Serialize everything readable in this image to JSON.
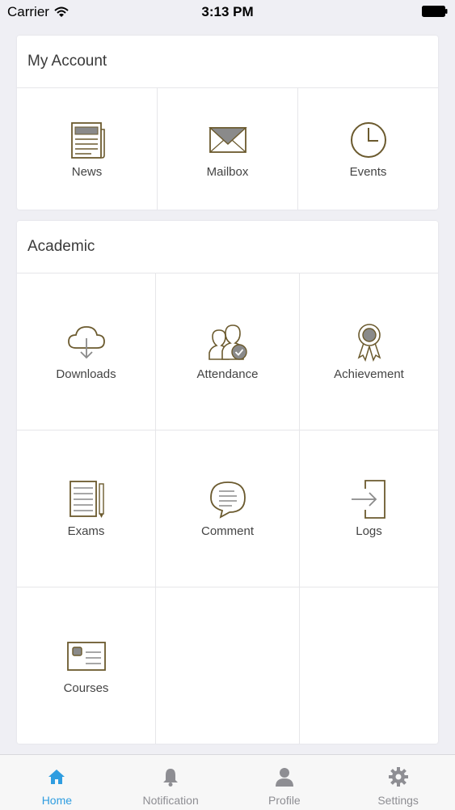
{
  "status_bar": {
    "carrier": "Carrier",
    "time": "3:13 PM"
  },
  "my_account": {
    "title": "My Account",
    "items": [
      {
        "label": "News",
        "icon": "newspaper-icon"
      },
      {
        "label": "Mailbox",
        "icon": "envelope-icon"
      },
      {
        "label": "Events",
        "icon": "clock-icon"
      }
    ]
  },
  "academic": {
    "title": "Academic",
    "items": [
      {
        "label": "Downloads",
        "icon": "cloud-download-icon"
      },
      {
        "label": "Attendance",
        "icon": "users-check-icon"
      },
      {
        "label": "Achievement",
        "icon": "award-ribbon-icon"
      },
      {
        "label": "Exams",
        "icon": "exam-paper-icon"
      },
      {
        "label": "Comment",
        "icon": "speech-bubble-icon"
      },
      {
        "label": "Logs",
        "icon": "login-arrow-icon"
      },
      {
        "label": "Courses",
        "icon": "course-card-icon"
      }
    ]
  },
  "tabbar": {
    "items": [
      {
        "label": "Home",
        "icon": "home-icon",
        "active": true
      },
      {
        "label": "Notification",
        "icon": "bell-icon"
      },
      {
        "label": "Profile",
        "icon": "person-icon"
      },
      {
        "label": "Settings",
        "icon": "gear-icon"
      }
    ]
  },
  "colors": {
    "icon": "#6b5a2e",
    "accent": "#2f9de0",
    "inactive": "#8e8e93"
  }
}
